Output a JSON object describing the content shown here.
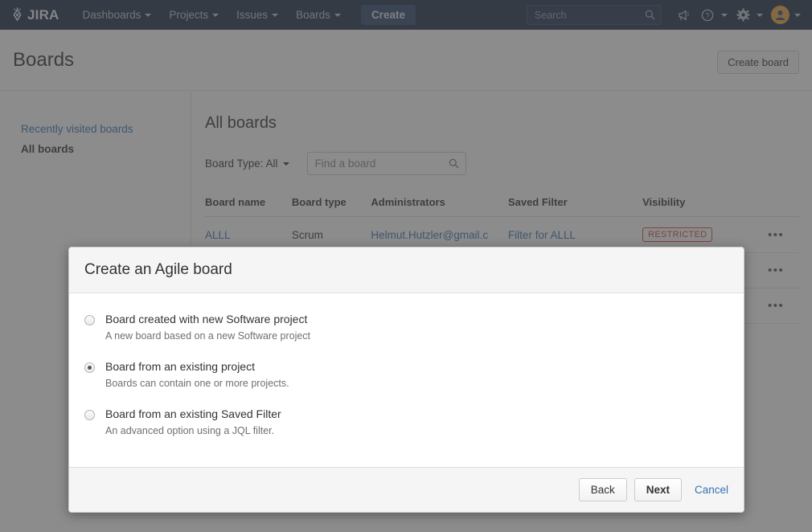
{
  "navbar": {
    "logo_text": "JIRA",
    "logo_icon": "jira-diamond-icon",
    "items": [
      {
        "label": "Dashboards",
        "has_caret": true
      },
      {
        "label": "Projects",
        "has_caret": true
      },
      {
        "label": "Issues",
        "has_caret": true
      },
      {
        "label": "Boards",
        "has_caret": true
      }
    ],
    "create_label": "Create",
    "search_placeholder": "Search",
    "search_value": "",
    "icons": [
      {
        "name": "megaphone-icon"
      },
      {
        "name": "help-icon"
      },
      {
        "name": "gear-icon"
      },
      {
        "name": "avatar-icon"
      }
    ]
  },
  "page": {
    "title": "Boards",
    "create_board_label": "Create board"
  },
  "sidebar": {
    "items": [
      {
        "label": "Recently visited boards",
        "active": false
      },
      {
        "label": "All boards",
        "active": true
      }
    ]
  },
  "main": {
    "title": "All boards",
    "board_type_label": "Board Type: All",
    "find_placeholder": "Find a board",
    "find_value": "",
    "table": {
      "headers": [
        "Board name",
        "Board type",
        "Administrators",
        "Saved Filter",
        "Visibility",
        ""
      ],
      "rows": [
        {
          "name": "ALLL",
          "type": "Scrum",
          "administrators": "Helmut.Hutzler@gmail.c",
          "saved_filter": "Filter for ALLL",
          "visibility": "RESTRICTED",
          "actions": "•••"
        },
        {
          "name": "",
          "type": "",
          "administrators": "",
          "saved_filter": "",
          "visibility": "",
          "actions": "•••"
        },
        {
          "name": "",
          "type": "",
          "administrators": "",
          "saved_filter": "",
          "visibility": "",
          "actions": "•••"
        }
      ]
    }
  },
  "modal": {
    "title": "Create an Agile board",
    "options": [
      {
        "label": "Board created with new Software project",
        "description": "A new board based on a new Software project",
        "selected": false
      },
      {
        "label": "Board from an existing project",
        "description": "Boards can contain one or more projects.",
        "selected": true
      },
      {
        "label": "Board from an existing Saved Filter",
        "description": "An advanced option using a JQL filter.",
        "selected": false
      }
    ],
    "back_label": "Back",
    "next_label": "Next",
    "cancel_label": "Cancel"
  },
  "colors": {
    "nav_bg": "#1b2b43",
    "link": "#3572b0",
    "restricted": "#d04437",
    "avatar": "#e8a33d"
  }
}
